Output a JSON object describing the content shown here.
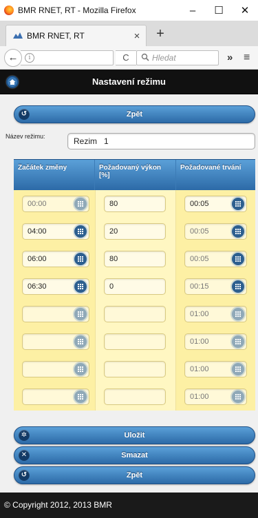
{
  "window": {
    "title": "BMR RNET, RT - Mozilla Firefox",
    "minimize": "–",
    "maximize": "☐",
    "close": "✕"
  },
  "tab": {
    "icon_text": "ᴮᴹ",
    "title": "BMR RNET, RT",
    "close": "×",
    "new_tab": "+"
  },
  "nav": {
    "back": "←",
    "info": "i",
    "reload": "C",
    "search_placeholder": "Hledat",
    "overflow": "»",
    "menu": "≡"
  },
  "header": {
    "title": "Nastavení režimu"
  },
  "buttons": {
    "back_top": "Zpět",
    "save": "Uložit",
    "delete": "Smazat",
    "back_bottom": "Zpět"
  },
  "name": {
    "label": "Název režimu:",
    "value": "Rezim   1"
  },
  "grid": {
    "headers": [
      "Začátek změny",
      "Požadovaný výkon [%]",
      "Požadované trvání"
    ],
    "rows": [
      {
        "start": "00:00",
        "power": "80",
        "duration": "00:05",
        "start_active": false,
        "duration_active": true
      },
      {
        "start": "04:00",
        "power": "20",
        "duration": "00:05",
        "start_active": true,
        "duration_active": false
      },
      {
        "start": "06:00",
        "power": "80",
        "duration": "00:05",
        "start_active": true,
        "duration_active": false
      },
      {
        "start": "06:30",
        "power": "0",
        "duration": "00:15",
        "start_active": true,
        "duration_active": false
      },
      {
        "start": "",
        "power": "",
        "duration": "01:00",
        "start_active": false,
        "duration_active": false
      },
      {
        "start": "",
        "power": "",
        "duration": "01:00",
        "start_active": false,
        "duration_active": false
      },
      {
        "start": "",
        "power": "",
        "duration": "01:00",
        "start_active": false,
        "duration_active": false
      },
      {
        "start": "",
        "power": "",
        "duration": "01:00",
        "start_active": false,
        "duration_active": false
      }
    ]
  },
  "footer": {
    "text": "© Copyright 2012, 2013 BMR"
  },
  "colors": {
    "button_top": "#5ba0d8",
    "button_bottom": "#2c6aa7",
    "row_bg": "#fdf0a4",
    "header_bg": "#111111"
  }
}
